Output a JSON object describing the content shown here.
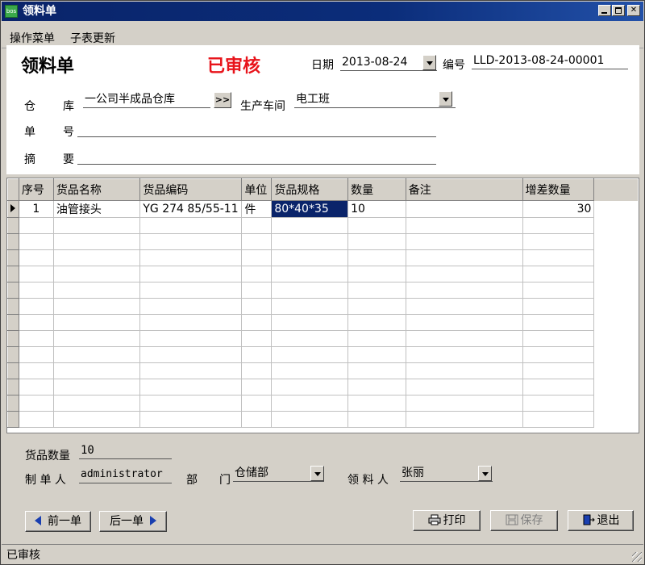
{
  "window": {
    "title": "领料单",
    "icon_text": "bos"
  },
  "menu": {
    "items": [
      "操作菜单",
      "子表更新"
    ]
  },
  "header": {
    "doc_title": "领料单",
    "status": "已审核",
    "date_label": "日期",
    "date_value": "2013-08-24",
    "number_label": "编号",
    "number_value": "LLD-2013-08-24-00001",
    "warehouse_label_1": "仓",
    "warehouse_label_2": "库",
    "warehouse_value": "一公司半成品仓库",
    "more_button": ">>",
    "workshop_label": "生产车间",
    "workshop_value": "电工班",
    "order_label_1": "单",
    "order_label_2": "号",
    "order_value": "",
    "summary_label_1": "摘",
    "summary_label_2": "要",
    "summary_value": ""
  },
  "grid": {
    "columns": [
      "序号",
      "货品名称",
      "货品编码",
      "单位",
      "货品规格",
      "数量",
      "备注",
      "增差数量"
    ],
    "rows": [
      [
        "1",
        "油管接头",
        "YG 274 85/55-11",
        "件",
        "80*40*35",
        "10",
        "",
        "30"
      ]
    ],
    "empty_rows": 13
  },
  "footer": {
    "qty_label": "货品数量",
    "qty_value": "10",
    "maker_label": "制 单 人",
    "maker_value": "administrator",
    "dept_label_1": "部",
    "dept_label_2": "门",
    "dept_value": "仓储部",
    "receiver_label": "领 料 人",
    "receiver_value": "张丽"
  },
  "buttons": {
    "prev": "前一单",
    "next": "后一单",
    "print": "打印",
    "save": "保存",
    "exit": "退出"
  },
  "statusbar": {
    "text": "已审核"
  },
  "colors": {
    "title_bar": "#0a246a",
    "status_red": "#e8141b",
    "selection": "#0a246a",
    "face": "#d4d0c8"
  }
}
